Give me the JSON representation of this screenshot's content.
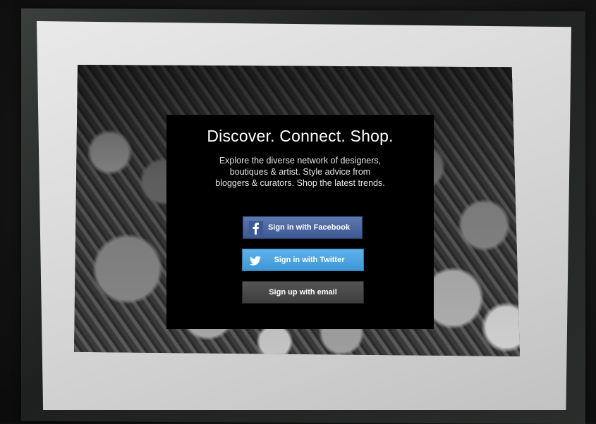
{
  "overlay": {
    "headline": "Discover. Connect. Shop.",
    "tagline": "Explore the diverse network of designers, boutiques & artist. Style advice from bloggers & curators. Shop the latest trends."
  },
  "buttons": {
    "facebook_label": "Sign in with Facebook",
    "twitter_label": "Sign in with Twitter",
    "email_label": "Sign up with email"
  },
  "icons": {
    "facebook": "facebook-icon",
    "twitter": "twitter-icon"
  },
  "colors": {
    "facebook": "#3c5893",
    "twitter": "#3c97d6",
    "email": "#3e3e3e",
    "overlay": "#000000"
  }
}
